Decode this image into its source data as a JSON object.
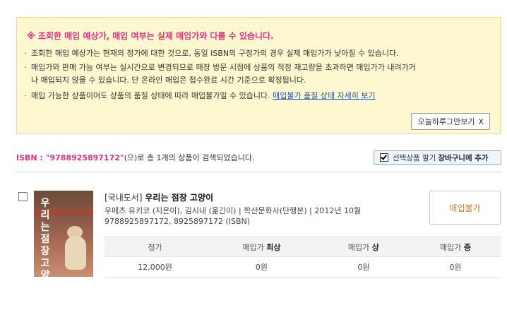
{
  "notice": {
    "title": "※ 조회한 매입 예상가, 매입 여부는 실제 매입가와 다를 수 있습니다.",
    "line1": "조회한 매입 예상가는 현재의 정가에 대한 것으로, 동일 ISBN의 구정가의 경우 실제 매입가가 낮아질 수 있습니다.",
    "line2a": "매입가와 판매 가능 여부는 실시간으로 변경되므로 매장 방문 시점에 상품의 적정 재고량을 초과하면 매입가가 내려가거",
    "line2b": "나 매입되지 않을 수 있습니다. 단 온라인 매입은 접수완료 시간 기준으로 확정됩니다.",
    "line3": "매입 가능한 상품이어도 상품의 품질 상태에 따라 매입불가일 수 있습니다.",
    "line3_link": "매입불가 품질 상태 자세히 보기",
    "hide_today": "오늘하루그만보기",
    "hide_today_x": "X"
  },
  "search_result": {
    "prefix": "ISBN : \"9788925897172\"",
    "suffix": "(으)로 총 1개의 상품이 검색되었습니다."
  },
  "cart_button": {
    "label": "선택상품 팔기",
    "bold": "장바구니에 추가"
  },
  "book": {
    "category": "[국내도서]",
    "title": "우리는 점장 고양이",
    "meta": "우메츠 유키코 (지은이), 김시내 (옮긴이) | 학산문화사(단행본) | 2012년 10월",
    "isbn": "9788925897172, 8925897172 (ISBN)",
    "cover_text": "우리는 점장 고양이",
    "buy_button": "매입불가"
  },
  "price_table": {
    "headers": [
      {
        "pre": "정가",
        "bold": ""
      },
      {
        "pre": "매입가 ",
        "bold": "최상"
      },
      {
        "pre": "매입가 ",
        "bold": "상"
      },
      {
        "pre": "매입가 ",
        "bold": "중"
      }
    ],
    "row": [
      "12,000원",
      "0원",
      "0원",
      "0원"
    ]
  }
}
